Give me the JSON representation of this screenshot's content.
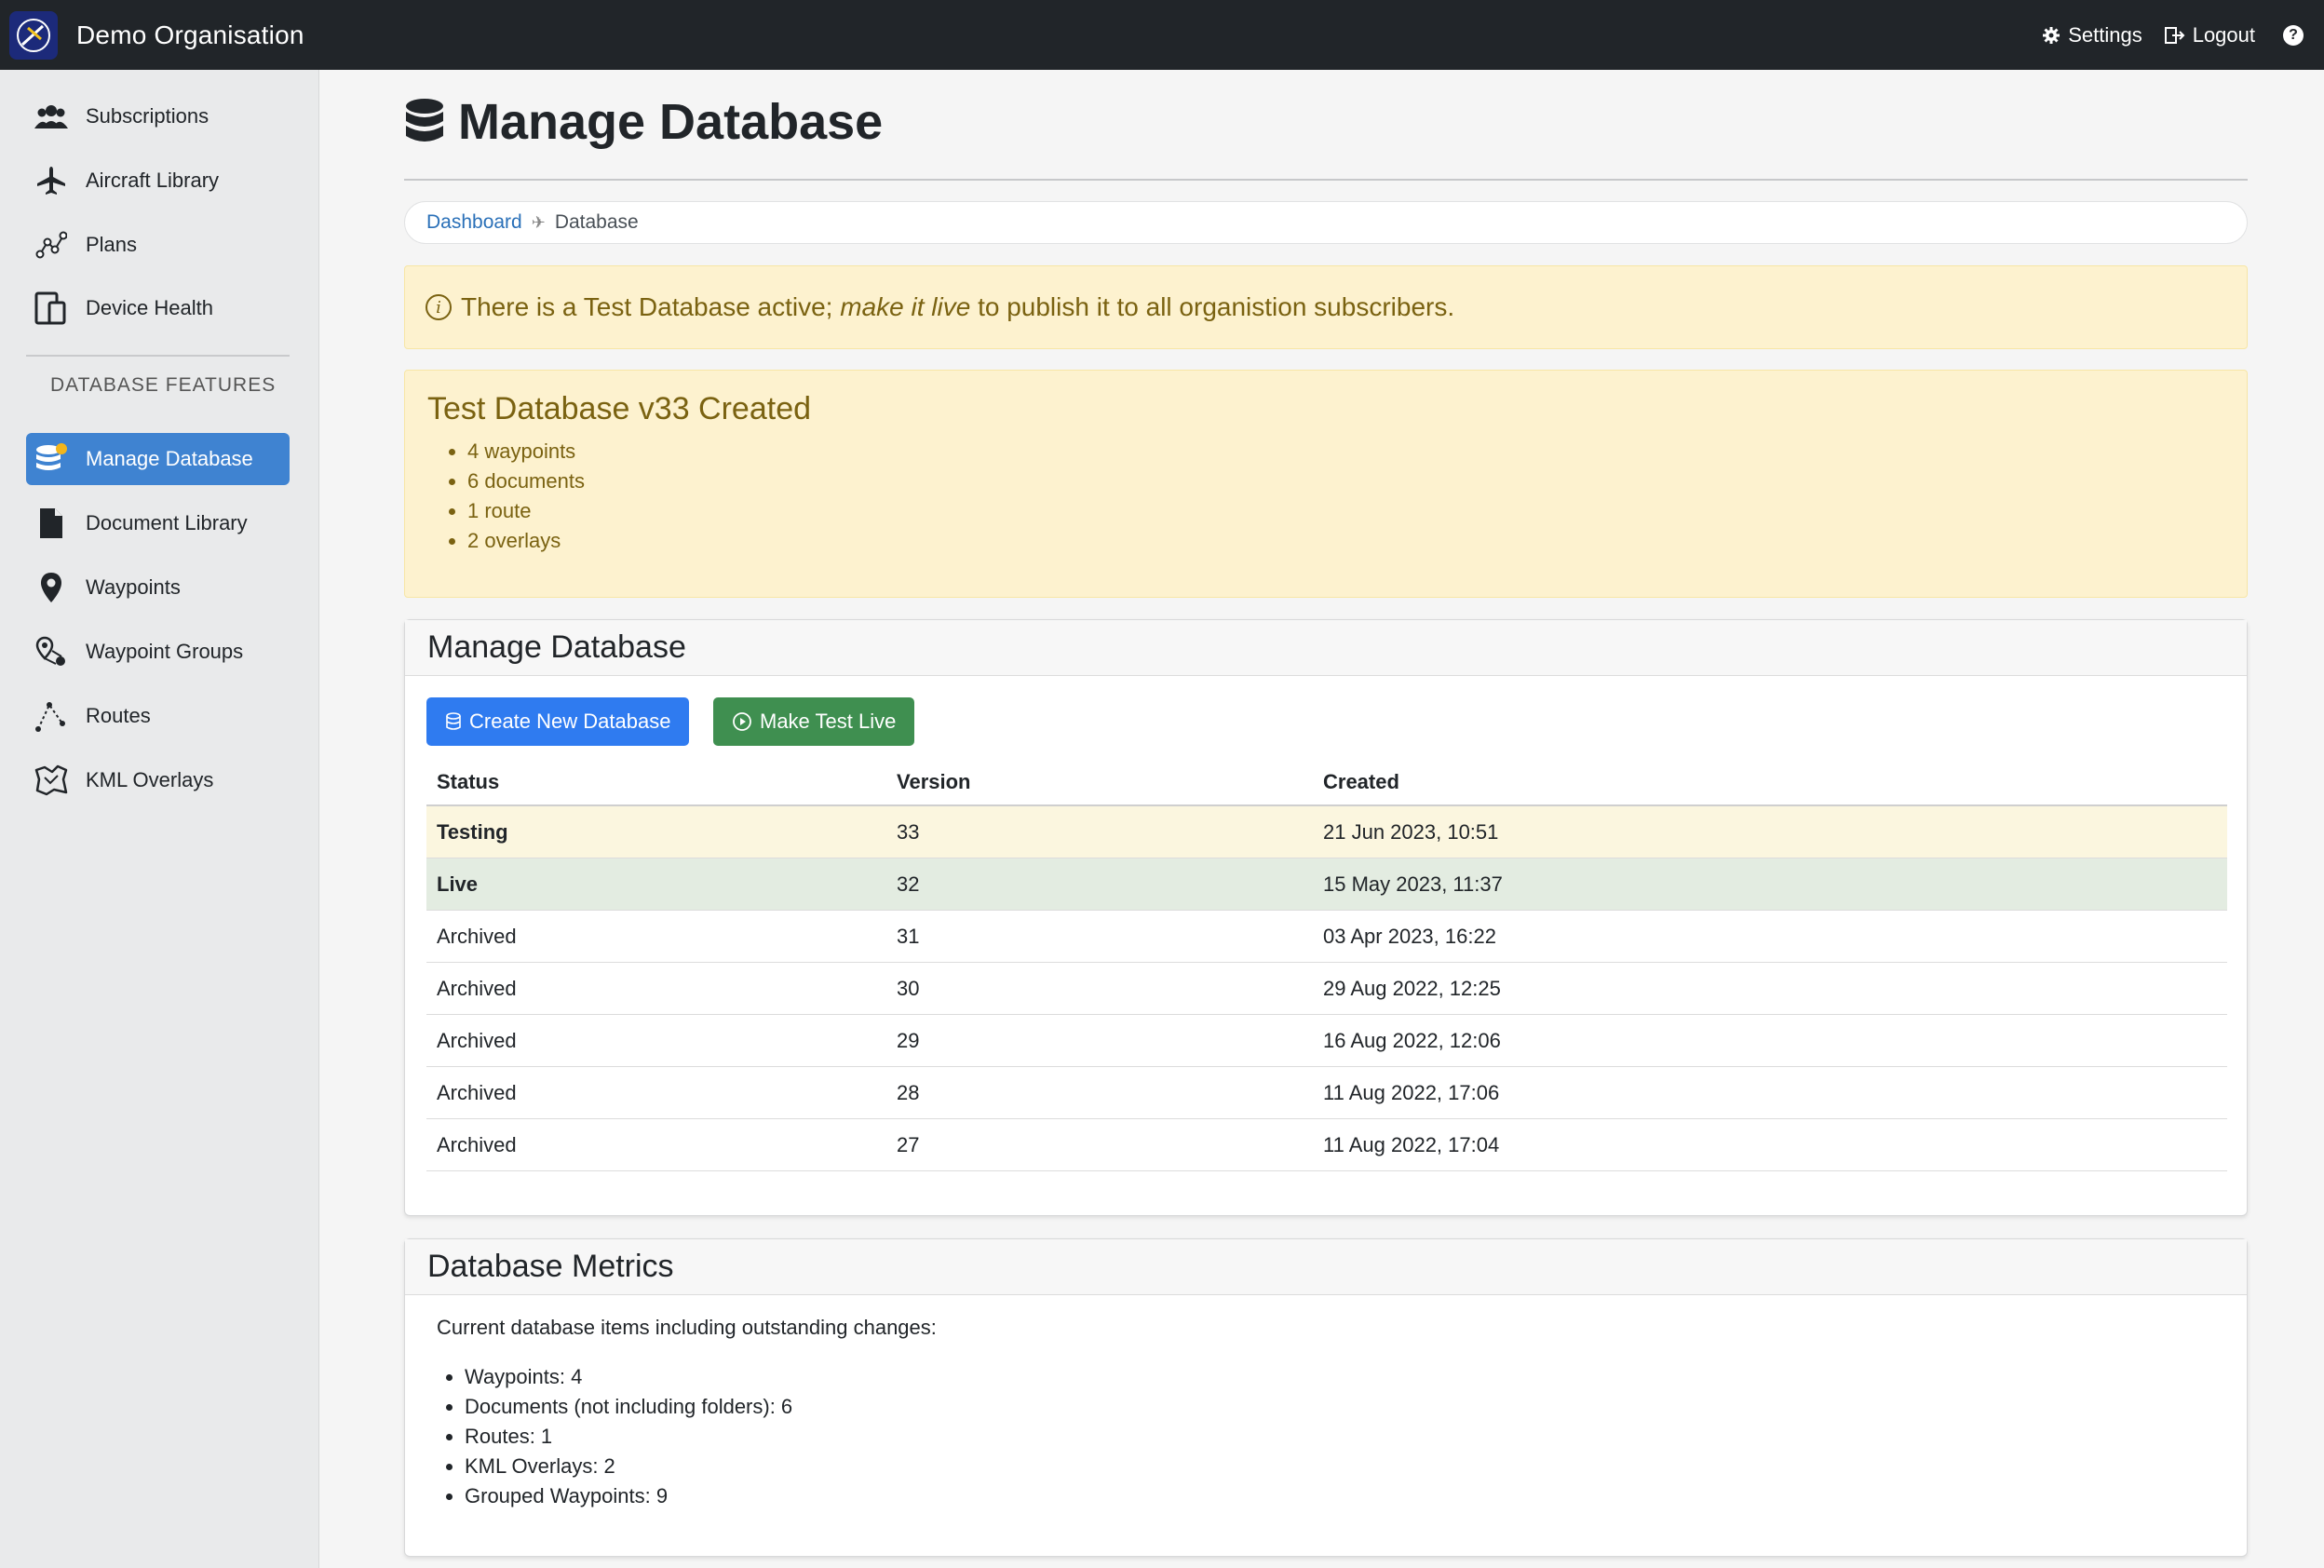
{
  "topbar": {
    "org_name": "Demo Organisation",
    "settings_label": "Settings",
    "logout_label": "Logout",
    "help_label": "?"
  },
  "sidebar": {
    "items": [
      {
        "label": "Subscriptions",
        "icon": "users-icon"
      },
      {
        "label": "Aircraft Library",
        "icon": "plane-icon"
      },
      {
        "label": "Plans",
        "icon": "route-nodes-icon"
      },
      {
        "label": "Device Health",
        "icon": "devices-icon"
      }
    ],
    "section_title": "DATABASE FEATURES",
    "db_items": [
      {
        "label": "Manage Database",
        "icon": "database-icon",
        "active": true
      },
      {
        "label": "Document Library",
        "icon": "file-icon"
      },
      {
        "label": "Waypoints",
        "icon": "map-pin-icon"
      },
      {
        "label": "Waypoint Groups",
        "icon": "pin-group-icon"
      },
      {
        "label": "Routes",
        "icon": "route-icon"
      },
      {
        "label": "KML Overlays",
        "icon": "map-overlay-icon"
      }
    ]
  },
  "page": {
    "title": "Manage Database",
    "breadcrumb": {
      "home": "Dashboard",
      "current": "Database"
    }
  },
  "alert": {
    "text_before": "There is a Test Database active; ",
    "emphasis": "make it live",
    "text_after": " to publish it to all organistion subscribers."
  },
  "created_box": {
    "title": "Test Database v33 Created",
    "items": [
      "4 waypoints",
      "6 documents",
      "1 route",
      "2 overlays"
    ]
  },
  "manage_card": {
    "title": "Manage Database",
    "create_button": "Create New Database",
    "live_button": "Make Test Live",
    "columns": [
      "Status",
      "Version",
      "Created"
    ],
    "rows": [
      {
        "status": "Testing",
        "version": "33",
        "created": "21 Jun 2023, 10:51"
      },
      {
        "status": "Live",
        "version": "32",
        "created": "15 May 2023, 11:37"
      },
      {
        "status": "Archived",
        "version": "31",
        "created": "03 Apr 2023, 16:22"
      },
      {
        "status": "Archived",
        "version": "30",
        "created": "29 Aug 2022, 12:25"
      },
      {
        "status": "Archived",
        "version": "29",
        "created": "16 Aug 2022, 12:06"
      },
      {
        "status": "Archived",
        "version": "28",
        "created": "11 Aug 2022, 17:06"
      },
      {
        "status": "Archived",
        "version": "27",
        "created": "11 Aug 2022, 17:04"
      }
    ]
  },
  "metrics_card": {
    "title": "Database Metrics",
    "intro": "Current database items including outstanding changes:",
    "items": [
      "Waypoints: 4",
      "Documents (not including folders): 6",
      "Routes: 1",
      "KML Overlays: 2",
      "Grouped Waypoints: 9"
    ]
  },
  "colors": {
    "topbar": "#212529",
    "sidebar": "#e9eaeb",
    "active_nav": "#3f83d1",
    "alert_bg": "#fdf2cf",
    "alert_text": "#7a6211",
    "primary": "#2f7bf0",
    "success": "#3f8f50",
    "testing_row": "#fbf6df",
    "live_row": "#e3ece1"
  }
}
